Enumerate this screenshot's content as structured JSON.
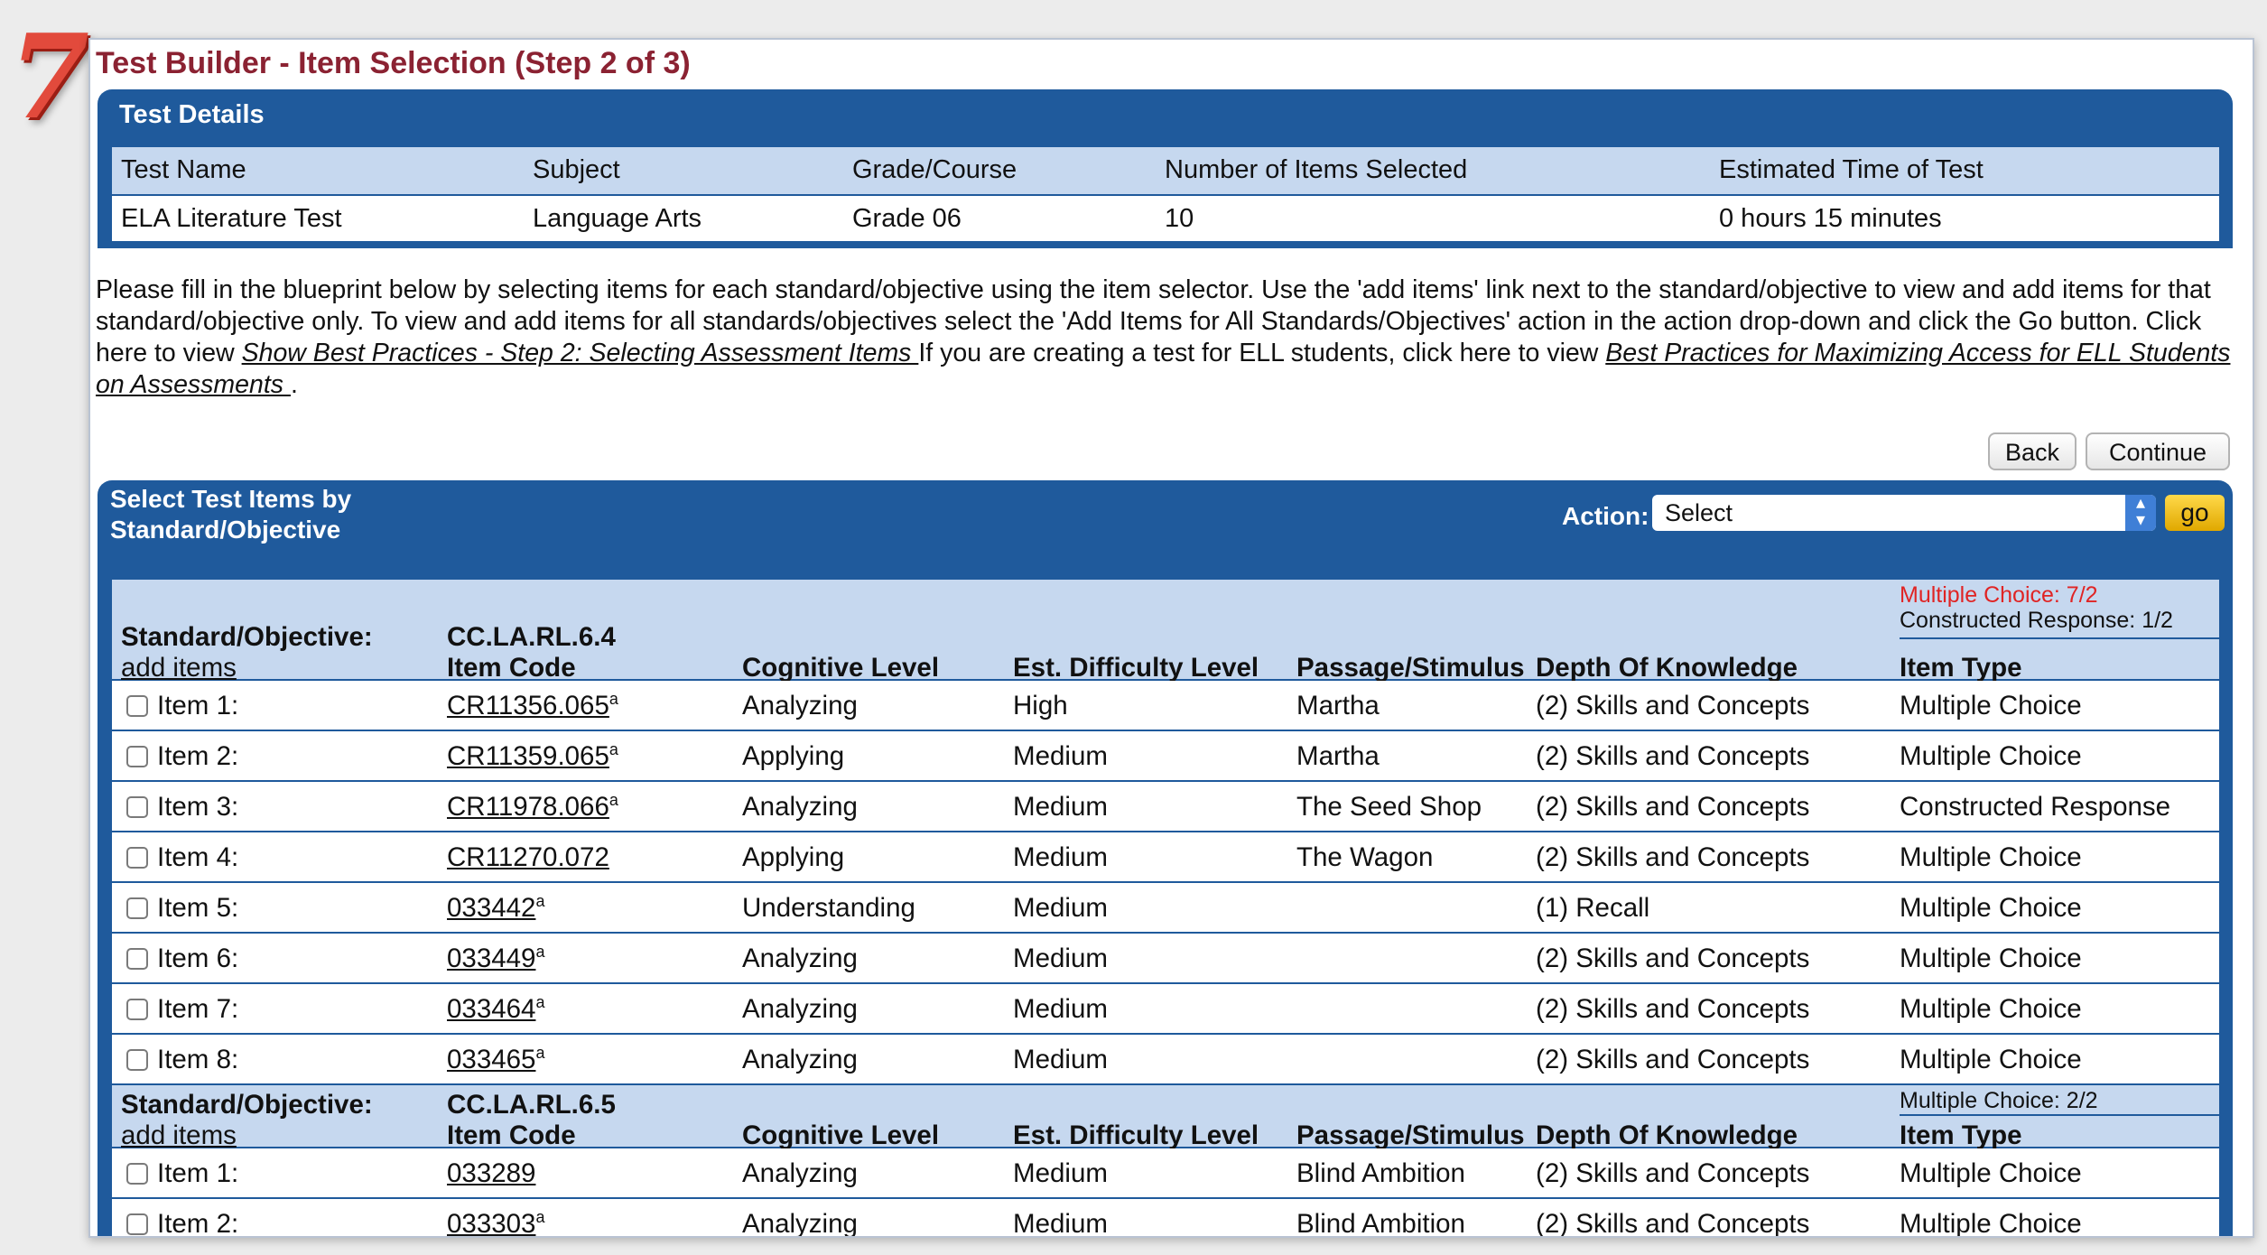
{
  "step_number": "7",
  "page_title": "Test Builder - Item Selection (Step 2 of 3)",
  "test_details": {
    "header": "Test Details",
    "columns": [
      "Test Name",
      "Subject",
      "Grade/Course",
      "Number of Items Selected",
      "Estimated Time of Test"
    ],
    "values": [
      "ELA Literature Test",
      "Language Arts",
      "Grade 06",
      "10",
      "0 hours 15 minutes"
    ]
  },
  "instructions": {
    "text1": "Please fill in the blueprint below by selecting items for each standard/objective using the item selector. Use the 'add items' link next to the standard/objective to view and add items for that standard/objective only. To view and add items for all standards/objectives select the 'Add Items for All Standards/Objectives' action in the action drop-down and click the Go button.   Click here to view ",
    "link1": "Show Best Practices - Step 2: Selecting Assessment Items ",
    "text2": "  If you are creating a test for ELL students, click here to view ",
    "link2": "Best Practices for Maximizing Access for ELL Students on Assessments ",
    "text3": "."
  },
  "buttons": {
    "back": "Back",
    "continue": "Continue"
  },
  "items_panel": {
    "header": "Select Test Items by Standard/Objective",
    "action_label": "Action:",
    "action_selected": "Select",
    "go_label": "go"
  },
  "columns": {
    "standard": "Standard/Objective:",
    "add_items": "add items",
    "item_code": "Item Code",
    "cognitive": "Cognitive Level",
    "difficulty": "Est. Difficulty Level",
    "passage": "Passage/Stimulus",
    "dok": "Depth Of Knowledge",
    "item_type": "Item Type"
  },
  "groups": [
    {
      "standard_code": "CC.LA.RL.6.4",
      "counts": [
        "Multiple Choice: 7/2",
        "Constructed Response: 1/2"
      ],
      "items": [
        {
          "label": "Item 1:",
          "code": "CR11356.065",
          "sup": "a",
          "cognitive": "Analyzing",
          "difficulty": "High",
          "passage": "Martha",
          "dok": "(2) Skills and Concepts",
          "type": "Multiple Choice"
        },
        {
          "label": "Item 2:",
          "code": "CR11359.065",
          "sup": "a",
          "cognitive": "Applying",
          "difficulty": "Medium",
          "passage": "Martha",
          "dok": "(2) Skills and Concepts",
          "type": "Multiple Choice"
        },
        {
          "label": "Item 3:",
          "code": "CR11978.066",
          "sup": "a",
          "cognitive": "Analyzing",
          "difficulty": "Medium",
          "passage": "The Seed Shop",
          "dok": "(2) Skills and Concepts",
          "type": "Constructed Response"
        },
        {
          "label": "Item 4:",
          "code": "CR11270.072",
          "sup": "",
          "cognitive": "Applying",
          "difficulty": "Medium",
          "passage": "The Wagon",
          "dok": "(2) Skills and Concepts",
          "type": "Multiple Choice"
        },
        {
          "label": "Item 5:",
          "code": "033442",
          "sup": "a",
          "cognitive": "Understanding",
          "difficulty": "Medium",
          "passage": "",
          "dok": "(1) Recall",
          "type": "Multiple Choice"
        },
        {
          "label": "Item 6:",
          "code": "033449",
          "sup": "a",
          "cognitive": "Analyzing",
          "difficulty": "Medium",
          "passage": "",
          "dok": "(2) Skills and Concepts",
          "type": "Multiple Choice"
        },
        {
          "label": "Item 7:",
          "code": "033464",
          "sup": "a",
          "cognitive": "Analyzing",
          "difficulty": "Medium",
          "passage": "",
          "dok": "(2) Skills and Concepts",
          "type": "Multiple Choice"
        },
        {
          "label": "Item 8:",
          "code": "033465",
          "sup": "a",
          "cognitive": "Analyzing",
          "difficulty": "Medium",
          "passage": "",
          "dok": "(2) Skills and Concepts",
          "type": "Multiple Choice"
        }
      ]
    },
    {
      "standard_code": "CC.LA.RL.6.5",
      "counts": [
        "Multiple Choice: 2/2"
      ],
      "items": [
        {
          "label": "Item 1:",
          "code": "033289",
          "sup": "",
          "cognitive": "Analyzing",
          "difficulty": "Medium",
          "passage": "Blind Ambition",
          "dok": "(2) Skills and Concepts",
          "type": "Multiple Choice"
        },
        {
          "label": "Item 2:",
          "code": "033303",
          "sup": "a",
          "cognitive": "Analyzing",
          "difficulty": "Medium",
          "passage": "Blind Ambition",
          "dok": "(2) Skills and Concepts",
          "type": "Multiple Choice"
        }
      ]
    }
  ]
}
